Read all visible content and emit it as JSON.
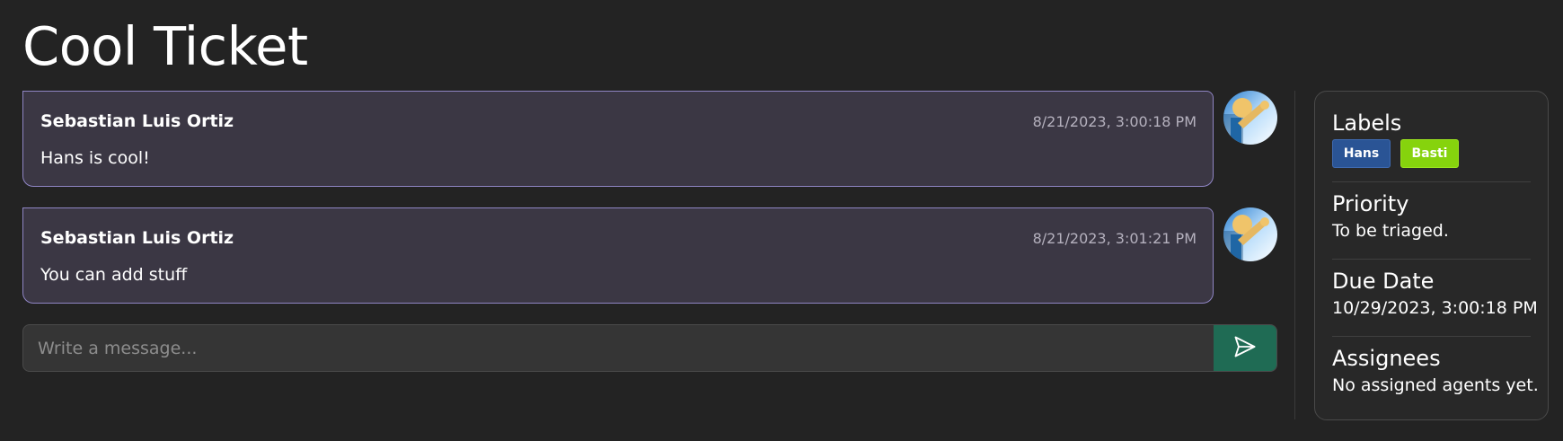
{
  "page": {
    "title": "Cool Ticket"
  },
  "messages": [
    {
      "author": "Sebastian Luis Ortiz",
      "timestamp": "8/21/2023, 3:00:18 PM",
      "text": "Hans is cool!",
      "avatar_icon": "user-avatar-icon"
    },
    {
      "author": "Sebastian Luis Ortiz",
      "timestamp": "8/21/2023, 3:01:21 PM",
      "text": "You can add stuff",
      "avatar_icon": "user-avatar-icon"
    }
  ],
  "composer": {
    "placeholder": "Write a message...",
    "value": "",
    "send_icon": "send-icon"
  },
  "sidebar": {
    "labels": {
      "title": "Labels",
      "items": [
        {
          "label": "Hans",
          "color": "#2a5495"
        },
        {
          "label": "Basti",
          "color": "#86d30d"
        }
      ]
    },
    "priority": {
      "title": "Priority",
      "value": "To be triaged."
    },
    "due_date": {
      "title": "Due Date",
      "value": "10/29/2023, 3:00:18 PM"
    },
    "assignees": {
      "title": "Assignees",
      "value": "No assigned agents yet."
    }
  },
  "colors": {
    "background": "#232323",
    "message_bg": "#3b3744",
    "message_border": "#8f85c4",
    "send_button": "#1f6b54"
  }
}
